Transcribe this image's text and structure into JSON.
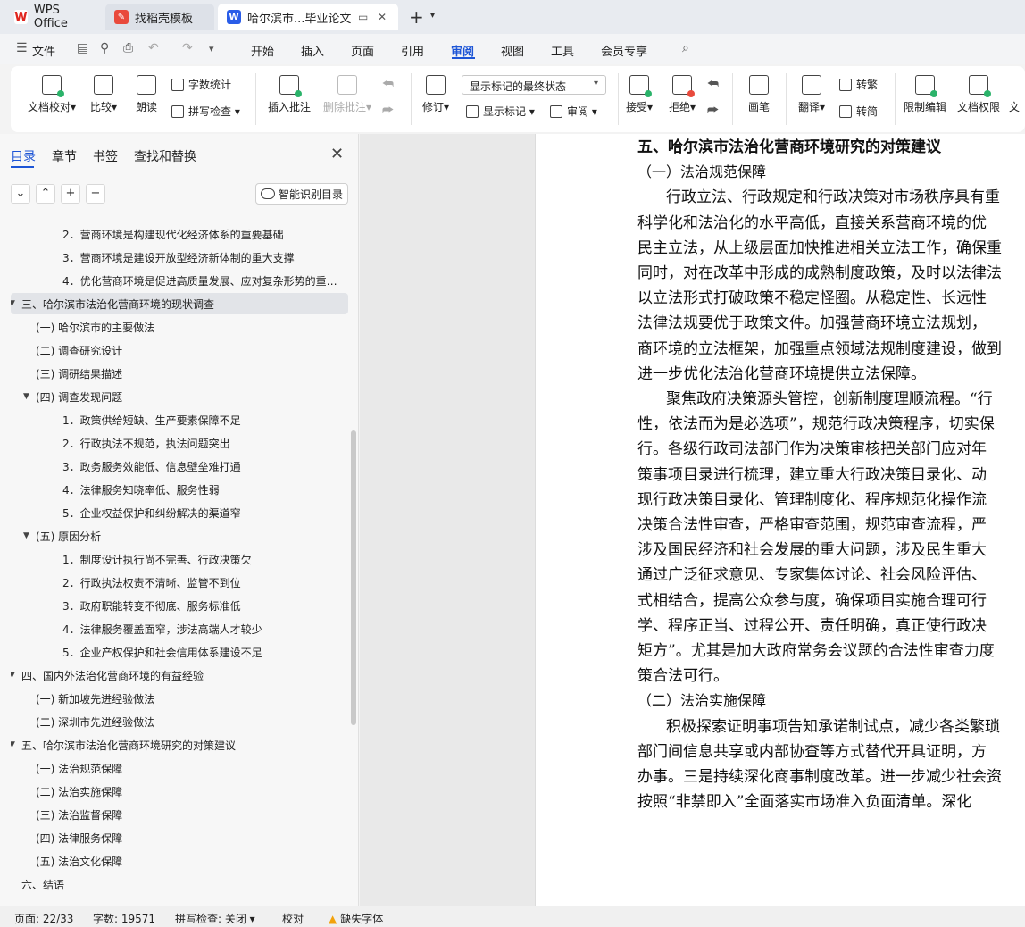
{
  "tabs": {
    "wps": "WPS Office",
    "template": "找稻壳模板",
    "document": "哈尔滨市...毕业论文"
  },
  "menu": {
    "file": "文件",
    "items": [
      "开始",
      "插入",
      "页面",
      "引用",
      "审阅",
      "视图",
      "工具",
      "会员专享"
    ],
    "active": "审阅"
  },
  "ribbon": {
    "doc_check": "文档校对",
    "compare": "比较",
    "read_aloud": "朗读",
    "word_count": "字数统计",
    "spell_check": "拼写检查",
    "insert_comment": "插入批注",
    "delete_comment": "删除批注",
    "revise": "修订",
    "markup_select": "显示标记的最终状态",
    "show_markup": "显示标记",
    "review": "审阅",
    "accept": "接受",
    "reject": "拒绝",
    "pen": "画笔",
    "translate": "翻译",
    "to_traditional": "转繁",
    "to_simplified": "转简",
    "restrict_edit": "限制编辑",
    "doc_permission": "文档权限",
    "doc_more": "文"
  },
  "pane": {
    "tabs": [
      "目录",
      "章节",
      "书签",
      "查找和替换"
    ],
    "smart_toc": "智能识别目录",
    "toc": [
      {
        "text": "2．营商环境是构建现代化经济体系的重要基础",
        "level": 3,
        "toggle": ""
      },
      {
        "text": "3．营商环境是建设开放型经济新体制的重大支撑",
        "level": 3,
        "toggle": ""
      },
      {
        "text": "4．优化营商环境是促进高质量发展、应对复杂形势的重…",
        "level": 3,
        "toggle": ""
      },
      {
        "text": "三、哈尔滨市法治化营商环境的现状调查",
        "level": 1,
        "toggle": "▼",
        "selected": true
      },
      {
        "text": "(一) 哈尔滨市的主要做法",
        "level": 2,
        "toggle": ""
      },
      {
        "text": "(二) 调查研究设计",
        "level": 2,
        "toggle": ""
      },
      {
        "text": "(三) 调研结果描述",
        "level": 2,
        "toggle": ""
      },
      {
        "text": "(四) 调查发现问题",
        "level": 2,
        "toggle": "▼"
      },
      {
        "text": "1．政策供给短缺、生产要素保障不足",
        "level": 3,
        "toggle": ""
      },
      {
        "text": "2．行政执法不规范，执法问题突出",
        "level": 3,
        "toggle": ""
      },
      {
        "text": "3．政务服务效能低、信息壁垒难打通",
        "level": 3,
        "toggle": ""
      },
      {
        "text": "4．法律服务知晓率低、服务性弱",
        "level": 3,
        "toggle": ""
      },
      {
        "text": "5．企业权益保护和纠纷解决的渠道窄",
        "level": 3,
        "toggle": ""
      },
      {
        "text": "(五) 原因分析",
        "level": 2,
        "toggle": "▼"
      },
      {
        "text": "1．制度设计执行尚不完善、行政决策欠",
        "level": 3,
        "toggle": ""
      },
      {
        "text": "2．行政执法权责不清晰、监管不到位",
        "level": 3,
        "toggle": ""
      },
      {
        "text": "3．政府职能转变不彻底、服务标准低",
        "level": 3,
        "toggle": ""
      },
      {
        "text": "4．法律服务覆盖面窄，涉法高端人才较少",
        "level": 3,
        "toggle": ""
      },
      {
        "text": "5．企业产权保护和社会信用体系建设不足",
        "level": 3,
        "toggle": ""
      },
      {
        "text": "四、国内外法治化营商环境的有益经验",
        "level": 1,
        "toggle": "▼"
      },
      {
        "text": "(一) 新加坡先进经验做法",
        "level": 2,
        "toggle": ""
      },
      {
        "text": "(二) 深圳市先进经验做法",
        "level": 2,
        "toggle": ""
      },
      {
        "text": "五、哈尔滨市法治化营商环境研究的对策建议",
        "level": 1,
        "toggle": "▼"
      },
      {
        "text": "(一) 法治规范保障",
        "level": 2,
        "toggle": ""
      },
      {
        "text": "(二) 法治实施保障",
        "level": 2,
        "toggle": ""
      },
      {
        "text": "(三) 法治监督保障",
        "level": 2,
        "toggle": ""
      },
      {
        "text": "(四) 法律服务保障",
        "level": 2,
        "toggle": ""
      },
      {
        "text": "(五) 法治文化保障",
        "level": 2,
        "toggle": ""
      },
      {
        "text": "六、结语",
        "level": 1,
        "toggle": ""
      }
    ]
  },
  "document": {
    "heading": "五、哈尔滨市法治化营商环境研究的对策建议",
    "sub1": "（一）法治规范保障",
    "p1": [
      "行政立法、行政规定和行政决策对市场秩序具有重",
      "科学化和法治化的水平高低，直接关系营商环境的优",
      "民主立法，从上级层面加快推进相关立法工作，确保重",
      "同时，对在改革中形成的成熟制度政策，及时以法律法",
      "以立法形式打破政策不稳定怪圈。从稳定性、长远性",
      "法律法规要优于政策文件。加强营商环境立法规划，",
      "商环境的立法框架，加强重点领域法规制度建设，做到",
      "进一步优化法治化营商环境提供立法保障。"
    ],
    "p2": [
      "聚焦政府决策源头管控，创新制度理顺流程。“行",
      "性，依法而为是必选项”，规范行政决策程序，切实保",
      "行。各级行政司法部门作为决策审核把关部门应对年",
      "策事项目录进行梳理，建立重大行政决策目录化、动",
      "现行政决策目录化、管理制度化、程序规范化操作流",
      "决策合法性审查，严格审查范围，规范审查流程，严",
      "涉及国民经济和社会发展的重大问题，涉及民生重大",
      "通过广泛征求意见、专家集体讨论、社会风险评估、",
      "式相结合，提高公众参与度，确保项目实施合理可行",
      "学、程序正当、过程公开、责任明确，真正使行政决",
      "矩方”。尤其是加大政府常务会议题的合法性审查力度",
      "策合法可行。"
    ],
    "sub2": "（二）法治实施保障",
    "p3": [
      "积极探索证明事项告知承诺制试点，减少各类繁琐",
      "部门间信息共享或内部协查等方式替代开具证明，方",
      "办事。三是持续深化商事制度改革。进一步减少社会资",
      "按照“非禁即入”全面落实市场准入负面清单。深化"
    ]
  },
  "status": {
    "page": "页面: 22/33",
    "words": "字数: 19571",
    "spell": "拼写检查: 关闭",
    "proof": "校对",
    "missing_font": "缺失字体"
  }
}
